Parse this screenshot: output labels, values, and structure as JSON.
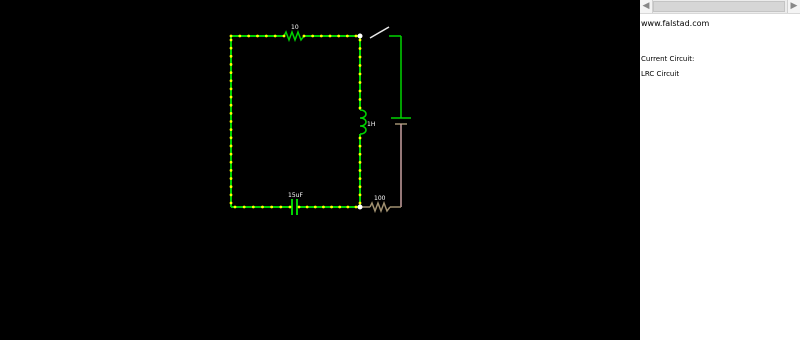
{
  "circuit": {
    "resistor_top_label": "10",
    "inductor_label": "1H",
    "capacitor_label": "15uF",
    "resistor_bottom_label": "100"
  },
  "side_panel": {
    "url": "www.falstad.com",
    "current_circuit_label": "Current Circuit:",
    "circuit_name": "LRC Circuit"
  },
  "colors": {
    "canvas_background": "#000000",
    "wire_active": "#00d400",
    "current_dot": "#ffff00",
    "inactive_component": "#a09070",
    "switch": "#e8e8e8",
    "panel_background": "#ffffff"
  },
  "icons": {
    "scroll_left": "left-arrow-icon",
    "scroll_right": "right-arrow-icon"
  }
}
